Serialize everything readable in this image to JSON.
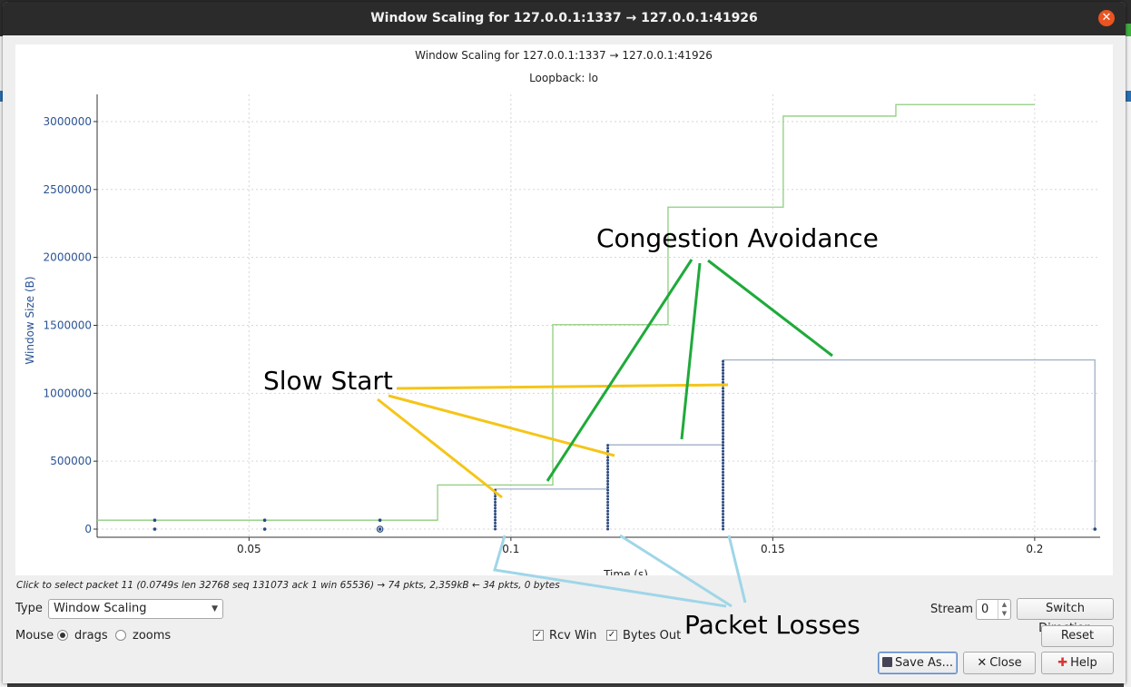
{
  "window": {
    "title": "Window Scaling for 127.0.0.1:1337 → 127.0.0.1:41926",
    "close_icon": "close-icon"
  },
  "chart_data": {
    "type": "line",
    "title": "Window Scaling for 127.0.0.1:1337 → 127.0.0.1:41926",
    "subtitle": "Loopback: lo",
    "xlabel": "Time (s)",
    "ylabel": "Window Size (B)",
    "xlim": [
      0.021,
      0.2125
    ],
    "ylim": [
      -60000,
      3200000
    ],
    "xticks": [
      0.05,
      0.1,
      0.15,
      0.2
    ],
    "xtick_labels": [
      "0.05",
      "0.1",
      "0.15",
      "0.2"
    ],
    "yticks": [
      0,
      500000,
      1000000,
      1500000,
      2000000,
      2500000,
      3000000
    ],
    "ytick_labels": [
      "0",
      "500000",
      "1000000",
      "1500000",
      "2000000",
      "2500000",
      "3000000"
    ],
    "grid": true,
    "series": [
      {
        "color": "#8fce7e",
        "style": "step",
        "x": [
          0.021,
          0.086,
          0.086,
          0.108,
          0.108,
          0.13,
          0.13,
          0.152,
          0.152,
          0.1735,
          0.1735,
          0.2
        ],
        "values": [
          65536,
          65536,
          325000,
          325000,
          1505000,
          1505000,
          2370000,
          2370000,
          3040000,
          3040000,
          3125000,
          3125000
        ]
      },
      {
        "color": "#9fb0c8",
        "style": "step",
        "x": [
          0.097,
          0.097,
          0.1185,
          0.1185,
          0.1405,
          0.1405,
          0.2115,
          0.2115
        ],
        "values": [
          65536,
          295000,
          295000,
          620000,
          620000,
          1245000,
          1245000,
          0
        ]
      },
      {
        "color": "#2a4a80",
        "style": "scatter",
        "x": [
          0.032,
          0.032,
          0.053,
          0.053,
          0.075,
          0.075,
          0.2115
        ],
        "values": [
          0,
          65536,
          0,
          65536,
          0,
          65536,
          0
        ]
      }
    ],
    "packet_columns": [
      {
        "x": 0.097,
        "top": 295000
      },
      {
        "x": 0.1185,
        "top": 620000
      },
      {
        "x": 0.1405,
        "top": 1245000
      }
    ]
  },
  "annotations": {
    "slow_start": "Slow Start",
    "congestion_avoidance": "Congestion Avoidance",
    "packet_losses": "Packet Losses"
  },
  "hint": "Click to select packet 11 (0.0749s len 32768 seq 131073 ack 1 win 65536) → 74 pkts, 2,359kB ← 34 pkts, 0 bytes",
  "controls": {
    "type_label": "Type",
    "type_value": "Window Scaling",
    "mouse_label": "Mouse",
    "drags_label": "drags",
    "zooms_label": "zooms",
    "rcv_win_label": "Rcv Win",
    "bytes_out_label": "Bytes Out",
    "stream_label": "Stream",
    "stream_value": "0",
    "switch_direction_label": "Switch Direction",
    "reset_label": "Reset",
    "save_as_label": "Save As...",
    "close_label": "Close",
    "help_label": "Help"
  }
}
